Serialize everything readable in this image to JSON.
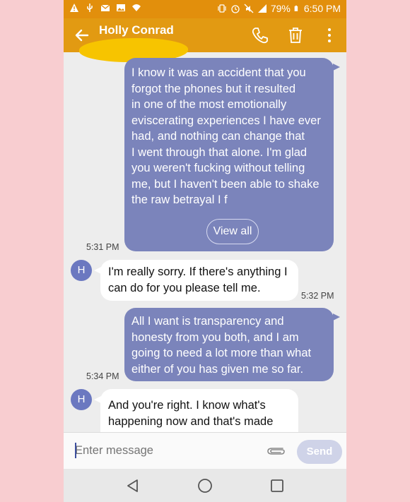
{
  "status_bar": {
    "left_icons": [
      "warning-icon",
      "usb-icon",
      "email-icon",
      "image-icon",
      "wifi-icon"
    ],
    "right_icons": [
      "vibrate-icon",
      "alarm-icon",
      "mute-icon",
      "signal-icon",
      "battery-icon"
    ],
    "battery": "79%",
    "time": "6:50 PM"
  },
  "header": {
    "contact_name": "Holly Conrad",
    "actions": [
      "call-icon",
      "delete-icon",
      "more-icon"
    ]
  },
  "messages": [
    {
      "direction": "outgoing",
      "lines": [
        "I know it was an accident that you",
        "forgot the phones but it resulted",
        "in one of the most emotionally",
        "eviscerating experiences I have ever",
        "had, and nothing can change that",
        "I went through that alone. I'm glad",
        "you weren't fucking without telling",
        "me, but I haven't been able to shake",
        "the raw betrayal I f"
      ],
      "view_all": "View all",
      "time": "5:31 PM"
    },
    {
      "direction": "incoming",
      "avatar": "H",
      "lines": [
        "I'm really sorry. If there's anything I",
        "can do for you please tell me."
      ],
      "time": "5:32 PM"
    },
    {
      "direction": "outgoing",
      "lines": [
        "All I want is transparency and",
        "honesty from you both, and I am",
        "going to need a lot more than what",
        "either of you has given me so far."
      ],
      "time": "5:34 PM"
    },
    {
      "direction": "incoming",
      "avatar": "H",
      "lines": [
        "And you're right. I know what's",
        "happening now and that's made"
      ]
    }
  ],
  "composer": {
    "placeholder": "Enter message",
    "send_label": "Send"
  },
  "nav": [
    "back-nav-icon",
    "home-nav-icon",
    "recents-nav-icon"
  ],
  "colors": {
    "app_bar": "#e29a12",
    "outgoing_bubble": "#7b84bb",
    "avatar": "#6b78c0",
    "background": "#f8cdd0"
  }
}
